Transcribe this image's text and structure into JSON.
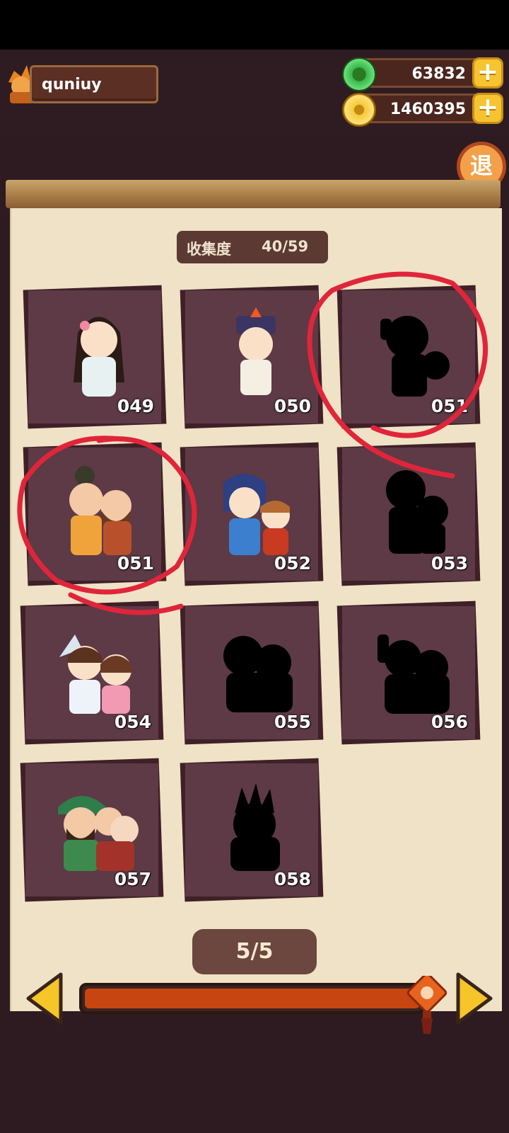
{
  "player": {
    "name": "quniuy"
  },
  "currency": {
    "jade": "63832",
    "coins": "1460395"
  },
  "exit_label": "退",
  "collection": {
    "label": "收集度",
    "count": "40/59"
  },
  "cards": [
    {
      "number": "049",
      "unlocked": true
    },
    {
      "number": "050",
      "unlocked": true
    },
    {
      "number": "051",
      "unlocked": false
    },
    {
      "number": "051",
      "unlocked": true
    },
    {
      "number": "052",
      "unlocked": true
    },
    {
      "number": "053",
      "unlocked": false
    },
    {
      "number": "054",
      "unlocked": true
    },
    {
      "number": "055",
      "unlocked": false
    },
    {
      "number": "056",
      "unlocked": false
    },
    {
      "number": "057",
      "unlocked": true
    },
    {
      "number": "058",
      "unlocked": false
    }
  ],
  "pagination": {
    "label": "5/5",
    "progress": 1.0
  },
  "colors": {
    "accent": "#c64510",
    "annotation": "#e0253a",
    "card": "#5d3a45"
  }
}
